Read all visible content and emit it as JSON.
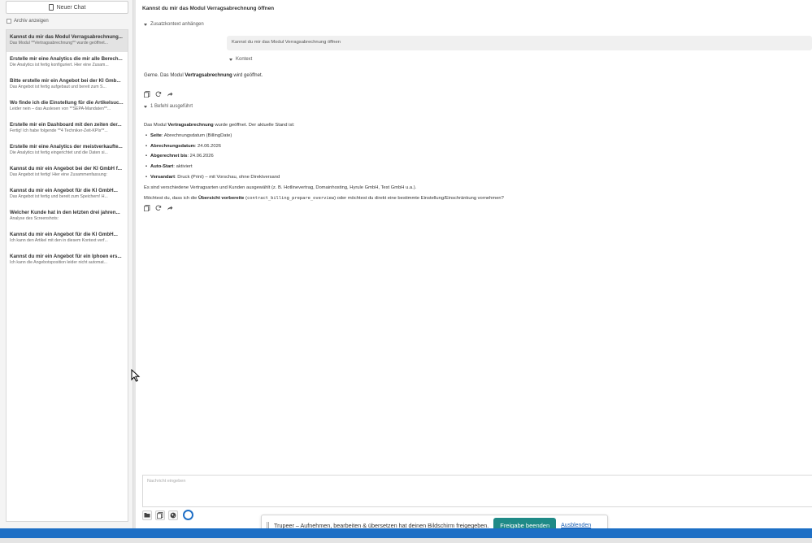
{
  "sidebar": {
    "new_chat_label": "Neuer Chat",
    "archive_label": "Archiv anzeigen",
    "chats": [
      {
        "title": "Kannst du mir das Modul Verragsabrechnung...",
        "snippet": "Das Modul **Vertragsabrechnung** wurde geöffnet..."
      },
      {
        "title": "Erstelle mir eine Analytics die mir alle Berech...",
        "snippet": "Die Analytics ist fertig konfiguriert. Hier eine Zusam..."
      },
      {
        "title": "Bitte erstelle mir ein Angebot bei der KI Gmb...",
        "snippet": "Das Angebot ist fertig aufgebaut und bereit zum S..."
      },
      {
        "title": "Wo finde ich die Einstellung für die Artikelsuc...",
        "snippet": "Leider nein – das Auslesen von **SEPA-Mandaten**..."
      },
      {
        "title": "Erstelle mir ein Dashboard mit den zeiten der...",
        "snippet": "Fertig! Ich habe folgende **4 Techniker-Zeit-KPIs**..."
      },
      {
        "title": "Erstelle mir eine Analytics der meistverkaufte...",
        "snippet": "Die Analytics ist fertig eingerichtet und die Daten si..."
      },
      {
        "title": "Kannst du mir ein Angebot bei der KI GmbH f...",
        "snippet": "Das Angebot ist fertig! Hier eine Zusammenfassung:"
      },
      {
        "title": "Kannst du mir ein Angebot für die KI GmbH...",
        "snippet": "Das Angebot ist fertig und bereit zum Speichern! H..."
      },
      {
        "title": "Welcher Kunde hat in den letzten drei jahren...",
        "snippet": "Analyse des Screenshots:"
      },
      {
        "title": "Kannst du mir ein Angebot für die KI GmbH...",
        "snippet": "Ich kann den Artikel mit den in diesem Kontext verf..."
      },
      {
        "title": "Kannst du mir ein Angebot für ein Iphoen ers...",
        "snippet": "Ich kann die Angebotsposition leider nicht automat..."
      }
    ]
  },
  "main": {
    "title": "Kannst du mir das Modul Verragsabrechnung öffnen",
    "zusatz_label": "Zusatzkontext anhängen",
    "user_message": "Kannst du mir das Modul Verragsabrechnung öffnen",
    "kontext_label": "Kontext",
    "reply_prefix": "Gerne. Das Modul ",
    "reply_bold": "Vertragsabrechnung",
    "reply_suffix": " wird geöffnet.",
    "befehl_label": "1 Befehl ausgeführt",
    "answer": {
      "intro_prefix": "Das Modul ",
      "intro_bold": "Vertragsabrechnung",
      "intro_suffix": " wurde geöffnet. Der aktuelle Stand ist:",
      "items": [
        {
          "label": "Seite",
          "value": ": Abrechnungsdatum (BillingDate)"
        },
        {
          "label": "Abrechnungsdatum",
          "value": ": 24.06.2026"
        },
        {
          "label": "Abgerechnet bis",
          "value": ": 24.06.2026"
        },
        {
          "label": "Auto-Start",
          "value": ": aktiviert"
        },
        {
          "label": "Versandart",
          "value": ": Druck (Print) – mit Vorschau, ohne Direktversand"
        }
      ],
      "line2": "Es sind verschiedene Vertragsarten und Kunden ausgewählt (z. B. Hotlinevertrag, Domainhosting, Hyrule GmbH, Test GmbH u.a.).",
      "q_prefix": "Möchtest du, dass ich die ",
      "q_bold": "Übersicht vorbereite",
      "q_mid": " (",
      "q_code": "contract_billing_prepare_overview",
      "q_suffix": ") oder möchtest du direkt eine bestimmte Einstellung/Einschränkung vornehmen?"
    },
    "input_placeholder": "Nachricht eingeben"
  },
  "share_bar": {
    "message": "Trupeer – Aufnehmen, bearbeiten & übersetzen hat deinen Bildschirm freigegeben.",
    "stop_label": "Freigabe beenden",
    "hide_label": "Ausblenden"
  },
  "colors": {
    "accent": "#1f8a87",
    "taskbar": "#1d6fc5",
    "link": "#1a5fb4"
  }
}
